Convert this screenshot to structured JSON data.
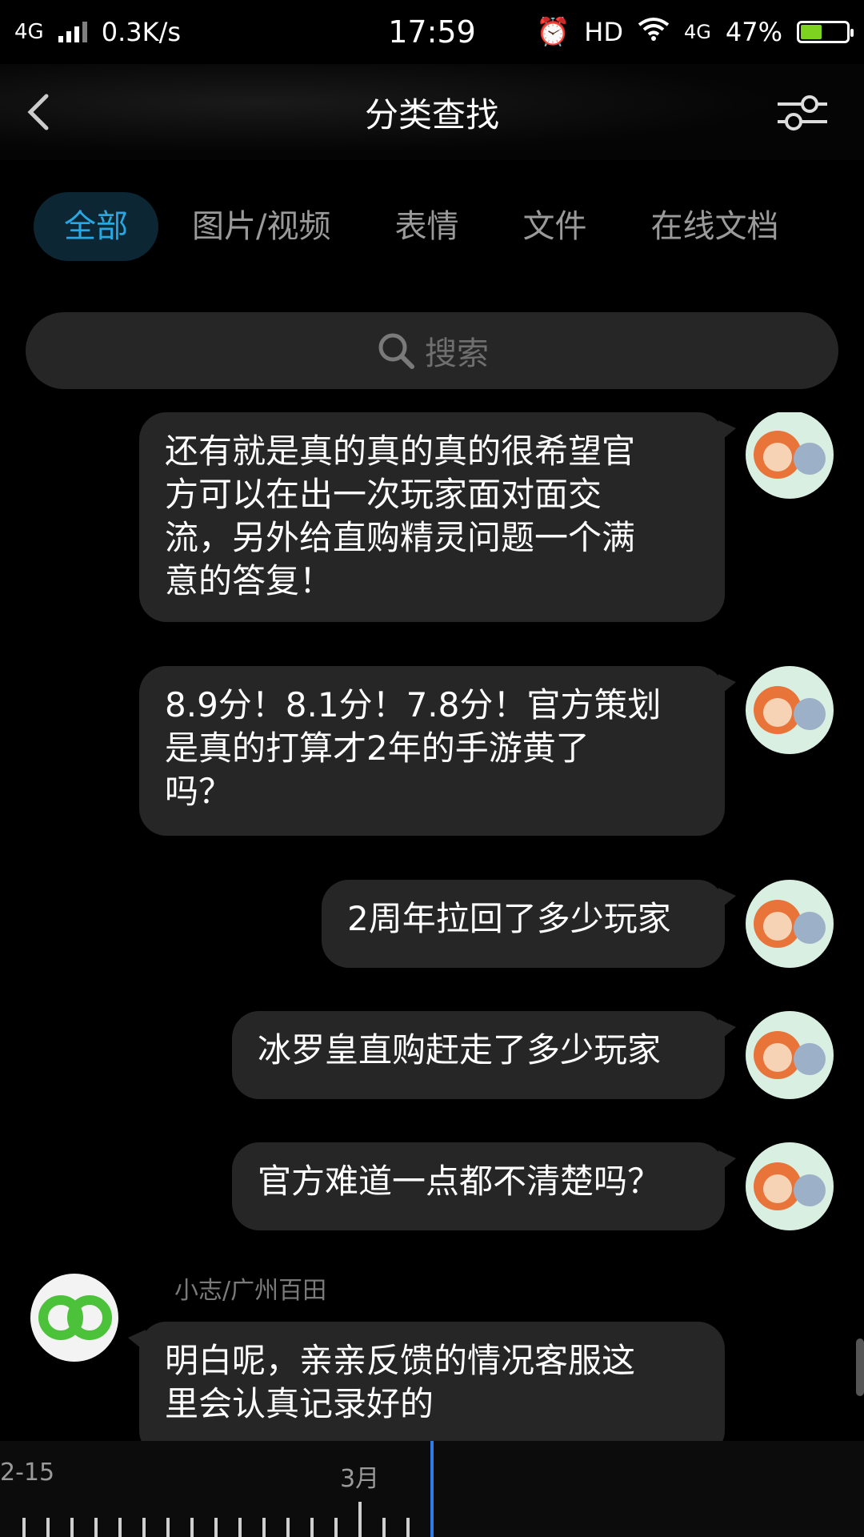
{
  "status_bar": {
    "network": "4G",
    "speed": "0.3K/s",
    "time": "17:59",
    "hd": "HD",
    "network2": "4G",
    "battery": "47%",
    "battery_level": 0.47
  },
  "header": {
    "title": "分类查找"
  },
  "tabs": [
    {
      "label": "全部",
      "active": true
    },
    {
      "label": "图片/视频"
    },
    {
      "label": "表情"
    },
    {
      "label": "文件"
    },
    {
      "label": "在线文档"
    }
  ],
  "search": {
    "placeholder": "搜索"
  },
  "messages": [
    {
      "side": "right",
      "lines": [
        "还有就是真的真的真的很希望官",
        "方可以在出一次玩家面对面交",
        "流，另外给直购精灵问题一个满",
        "意的答复！"
      ]
    },
    {
      "side": "right",
      "lines": [
        "8.9分！8.1分！7.8分！官方策划",
        "是真的打算才2年的手游黄了",
        "吗？"
      ]
    },
    {
      "side": "right",
      "lines": [
        "2周年拉回了多少玩家"
      ]
    },
    {
      "side": "right",
      "lines": [
        "冰罗皇直购赶走了多少玩家"
      ]
    },
    {
      "side": "right",
      "lines": [
        "官方难道一点都不清楚吗？"
      ]
    },
    {
      "side": "left",
      "sender": "小志/广州百田",
      "lines": [
        "明白呢，亲亲反馈的情况客服这",
        "里会认真记录好的"
      ]
    }
  ],
  "timeline": {
    "labels": [
      "2-15",
      "3月"
    ]
  },
  "colors": {
    "accent": "#2aa7e0",
    "bubble": "#262626",
    "cursor": "#2f7bea"
  }
}
